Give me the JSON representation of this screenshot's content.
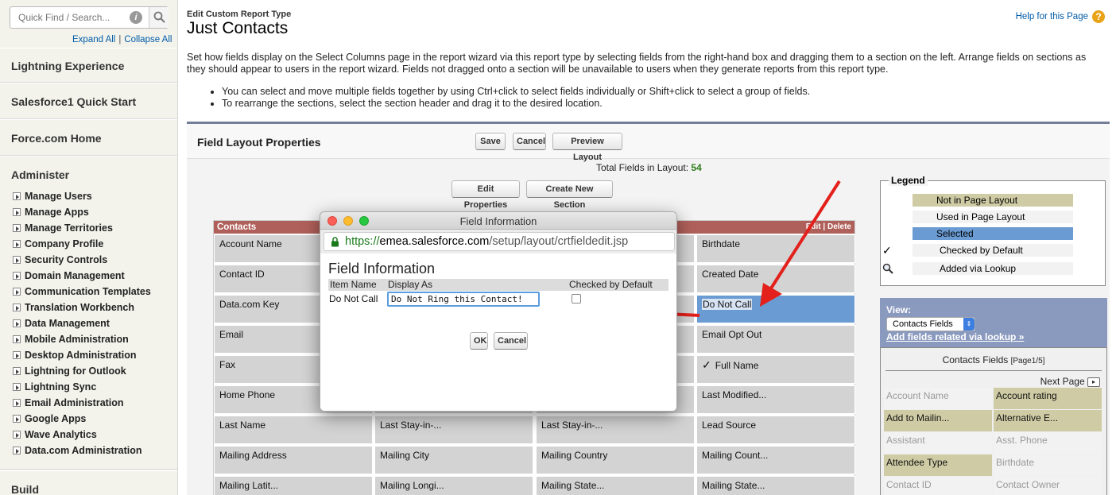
{
  "sidebar": {
    "search_placeholder": "Quick Find / Search...",
    "info_glyph": "i",
    "expand_all": "Expand All",
    "sep": "|",
    "collapse_all": "Collapse All",
    "lightning_experience": "Lightning Experience",
    "sf1_quick_start": "Salesforce1 Quick Start",
    "force_home": "Force.com Home",
    "administer": "Administer",
    "items": [
      "Manage Users",
      "Manage Apps",
      "Manage Territories",
      "Company Profile",
      "Security Controls",
      "Domain Management",
      "Communication Templates",
      "Translation Workbench",
      "Data Management",
      "Mobile Administration",
      "Desktop Administration",
      "Lightning for Outlook",
      "Lightning Sync",
      "Email Administration",
      "Google Apps",
      "Wave Analytics",
      "Data.com Administration"
    ],
    "build": "Build"
  },
  "header": {
    "breadcrumb": "Edit Custom Report Type",
    "title": "Just Contacts",
    "help": "Help for this Page",
    "help_glyph": "?"
  },
  "description": "Set how fields display on the Select Columns page in the report wizard via this report type by selecting fields from the right-hand box and dragging them to a section on the left. Arrange fields on sections as they should appear to users in the report wizard. Fields not dragged onto a section will be unavailable to users when they generate reports from this report type.",
  "tips": [
    "You can select and move multiple fields together by using Ctrl+click to select fields individually or Shift+click to select a group of fields.",
    "To rearrange the sections, select the section header and drag it to the desired location."
  ],
  "panel": {
    "title": "Field Layout Properties",
    "save": "Save",
    "cancel": "Cancel",
    "preview": "Preview Layout",
    "total_label": "Total Fields in Layout:",
    "total_value": "54",
    "edit_properties": "Edit Properties",
    "create_section": "Create New Section"
  },
  "section": {
    "name": "Contacts",
    "actions": "Edit | Delete",
    "col1": [
      "Account Name",
      "Contact ID",
      "Data.com Key",
      "Email",
      "Fax",
      "Home Phone",
      "Last Name",
      "Mailing Address",
      "Mailing Latit..."
    ],
    "col2": [
      "Last Stay-in-...",
      "Mailing City",
      "Mailing Longi..."
    ],
    "col3": [
      "Last Stay-in-...",
      "Mailing Country",
      "Mailing State..."
    ],
    "col4": [
      "Birthdate",
      "Created Date",
      "Do Not Call",
      "Email Opt Out",
      "Full Name",
      "Last Modified...",
      "Lead Source",
      "Mailing Count...",
      "Mailing State..."
    ],
    "check_glyph": "✓"
  },
  "legend": {
    "title": "Legend",
    "not_in_layout": "Not in Page Layout",
    "used_in_layout": "Used in Page Layout",
    "selected": "Selected",
    "checked_default": "Checked by Default",
    "added_lookup": "Added via Lookup",
    "check_glyph": "✓",
    "colors": {
      "not_in": "#cfcca5",
      "used": "#f2f2f2",
      "selected": "#6a9bd2"
    }
  },
  "lookup": {
    "view_label": "View:",
    "view_value": "Contacts Fields",
    "add_link": "Add fields related via lookup »",
    "box_title": "Contacts Fields",
    "page_indicator": "[Page1/5]",
    "next_page": "Next Page",
    "next_glyph": "▸",
    "fields": [
      {
        "label": "Account Name",
        "state": "used"
      },
      {
        "label": "Account rating",
        "state": "notin"
      },
      {
        "label": "Add to Mailin...",
        "state": "notin"
      },
      {
        "label": "Alternative E...",
        "state": "notin"
      },
      {
        "label": "Assistant",
        "state": "used"
      },
      {
        "label": "Asst. Phone",
        "state": "used"
      },
      {
        "label": "Attendee Type",
        "state": "notin"
      },
      {
        "label": "Birthdate",
        "state": "used"
      },
      {
        "label": "Contact ID",
        "state": "used"
      },
      {
        "label": "Contact Owner",
        "state": "used"
      }
    ]
  },
  "dialog": {
    "title": "Field Information",
    "url_scheme": "https://",
    "url_host": "emea.salesforce.com",
    "url_path": "/setup/layout/crtfieldedit.jsp",
    "heading": "Field Information",
    "col_item": "Item Name",
    "col_display": "Display As",
    "col_checked": "Checked by Default",
    "item_name": "Do Not Call",
    "display_as": "Do Not Ring this Contact!",
    "ok": "OK",
    "cancel": "Cancel"
  }
}
